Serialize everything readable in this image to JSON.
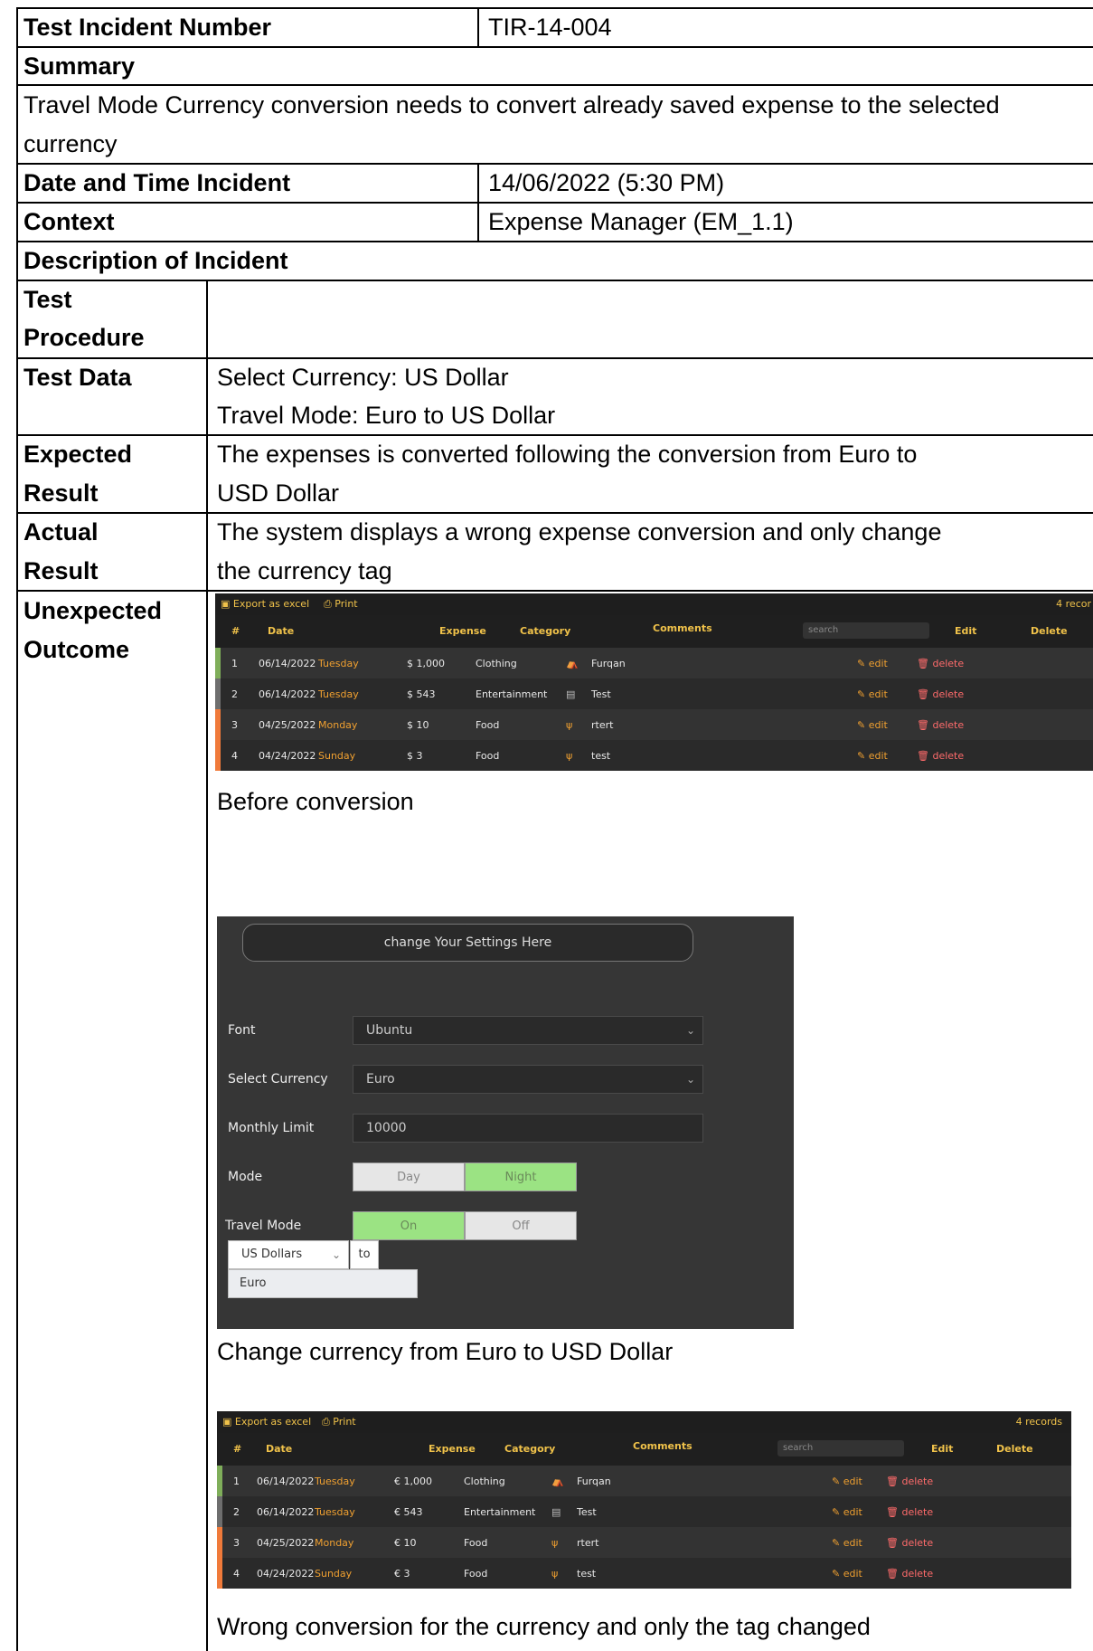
{
  "incident_number": {
    "label": "Test Incident Number",
    "value": "TIR-14-004"
  },
  "summary": {
    "label": "Summary",
    "text": "Travel Mode Currency conversion needs to convert already saved expense to the selected currency"
  },
  "date_time": {
    "label": "Date and Time Incident",
    "value": "14/06/2022 (5:30 PM)"
  },
  "context": {
    "label": "Context",
    "value": "Expense Manager (EM_1.1)"
  },
  "description_header": "Description of Incident",
  "procedure": {
    "label_line1": "Test",
    "label_line2": "Procedure",
    "value": ""
  },
  "test_data": {
    "label": "Test Data",
    "line1": "Select Currency: US Dollar",
    "line2": "Travel Mode: Euro to US Dollar"
  },
  "expected": {
    "label_line1": "Expected",
    "label_line2": "Result",
    "line1": "The expenses is converted following the conversion from Euro to",
    "line2": "USD Dollar"
  },
  "actual": {
    "label_line1": "Actual",
    "label_line2": "Result",
    "line1": "The system displays a wrong expense conversion and only change",
    "line2": "the currency tag"
  },
  "unexpected": {
    "label_line1": "Unexpected",
    "label_line2": "Outcome",
    "caption_before": "Before conversion",
    "caption_settings": "Change currency from Euro to USD Dollar",
    "caption_after": "Wrong conversion for the currency and only the tag changed"
  },
  "table_before": {
    "export_label": "Export as excel",
    "print_label": "Print",
    "records": "4 recor",
    "headers": {
      "num": "#",
      "date": "Date",
      "expense": "Expense",
      "category": "Category",
      "comments": "Comments",
      "search": "search",
      "edit": "Edit",
      "delete": "Delete"
    },
    "rows": [
      {
        "num": "1",
        "date": "06/14/2022",
        "day": "Tuesday",
        "expense": "$ 1,000",
        "category": "Clothing",
        "comment": "Furqan",
        "edit": "edit",
        "delete": "delete",
        "stripe": "#7fae5a",
        "icon": "bag"
      },
      {
        "num": "2",
        "date": "06/14/2022",
        "day": "Tuesday",
        "expense": "$ 543",
        "category": "Entertainment",
        "comment": "Test",
        "edit": "edit",
        "delete": "delete",
        "stripe": "#6e6e6e",
        "icon": "film"
      },
      {
        "num": "3",
        "date": "04/25/2022",
        "day": "Monday",
        "expense": "$ 10",
        "category": "Food",
        "comment": "rtert",
        "edit": "edit",
        "delete": "delete",
        "stripe": "#f07a3a",
        "icon": "fork-knife"
      },
      {
        "num": "4",
        "date": "04/24/2022",
        "day": "Sunday",
        "expense": "$ 3",
        "category": "Food",
        "comment": "test",
        "edit": "edit",
        "delete": "delete",
        "stripe": "#f07a3a",
        "icon": "fork-knife"
      }
    ]
  },
  "settings": {
    "banner": "change Your Settings Here",
    "font_label": "Font",
    "font_value": "Ubuntu",
    "currency_label": "Select Currency",
    "currency_value": "Euro",
    "limit_label": "Monthly Limit",
    "limit_value": "10000",
    "mode_label": "Mode",
    "mode_day": "Day",
    "mode_night": "Night",
    "travel_label": "Travel Mode",
    "travel_on": "On",
    "travel_off": "Off",
    "from_currency": "US Dollars",
    "to_label": "to",
    "dropdown_option": "Euro"
  },
  "table_after": {
    "export_label": "Export as excel",
    "print_label": "Print",
    "records": "4 records",
    "headers": {
      "num": "#",
      "date": "Date",
      "expense": "Expense",
      "category": "Category",
      "comments": "Comments",
      "search": "search",
      "edit": "Edit",
      "delete": "Delete"
    },
    "rows": [
      {
        "num": "1",
        "date": "06/14/2022",
        "day": "Tuesday",
        "expense": "€ 1,000",
        "category": "Clothing",
        "comment": "Furqan",
        "edit": "edit",
        "delete": "delete",
        "stripe": "#7fae5a",
        "icon": "bag"
      },
      {
        "num": "2",
        "date": "06/14/2022",
        "day": "Tuesday",
        "expense": "€ 543",
        "category": "Entertainment",
        "comment": "Test",
        "edit": "edit",
        "delete": "delete",
        "stripe": "#6e6e6e",
        "icon": "film"
      },
      {
        "num": "3",
        "date": "04/25/2022",
        "day": "Monday",
        "expense": "€ 10",
        "category": "Food",
        "comment": "rtert",
        "edit": "edit",
        "delete": "delete",
        "stripe": "#f07a3a",
        "icon": "fork-knife"
      },
      {
        "num": "4",
        "date": "04/24/2022",
        "day": "Sunday",
        "expense": "€ 3",
        "category": "Food",
        "comment": "test",
        "edit": "edit",
        "delete": "delete",
        "stripe": "#f07a3a",
        "icon": "fork-knife"
      }
    ]
  }
}
